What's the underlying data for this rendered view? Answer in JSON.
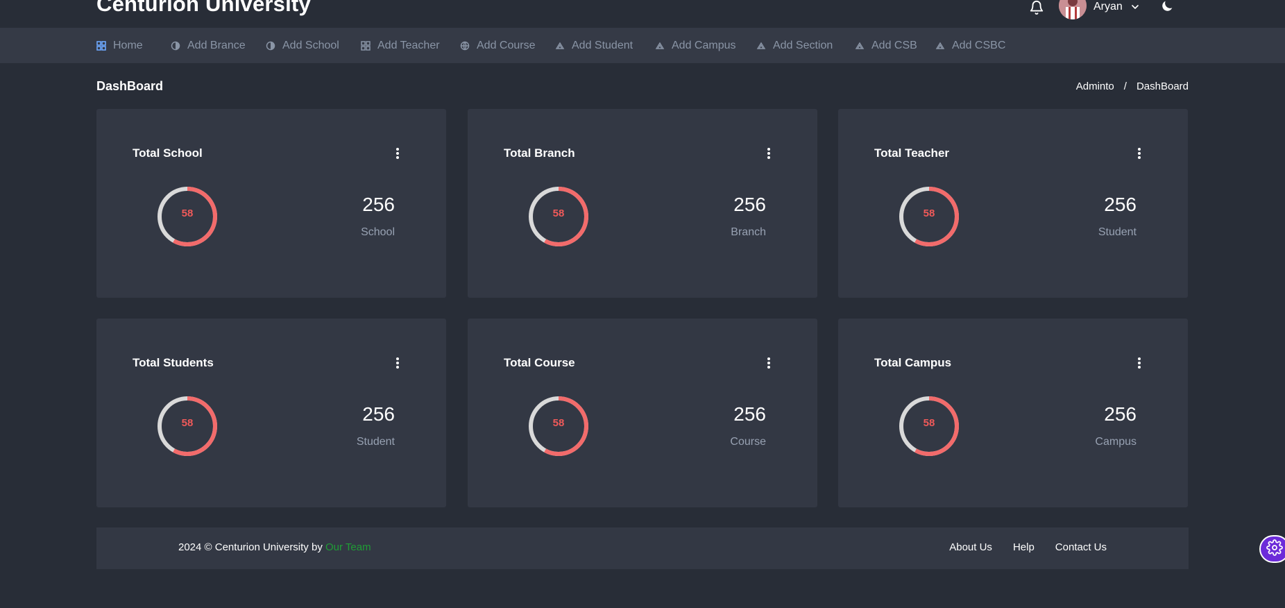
{
  "header": {
    "brand": "Centurion University",
    "username": "Aryan"
  },
  "nav": {
    "items": [
      {
        "label": "Home",
        "icon": "grid-icon"
      },
      {
        "label": "Add Brance",
        "icon": "half-circle-icon"
      },
      {
        "label": "Add School",
        "icon": "half-circle-icon"
      },
      {
        "label": "Add Teacher",
        "icon": "grid-icon"
      },
      {
        "label": "Add Course",
        "icon": "globe-icon"
      },
      {
        "label": "Add Student",
        "icon": "layers-icon"
      },
      {
        "label": "Add Campus",
        "icon": "layers-icon"
      },
      {
        "label": "Add Section",
        "icon": "layers-icon"
      },
      {
        "label": "Add CSB",
        "icon": "layers-icon"
      },
      {
        "label": "Add CSBC",
        "icon": "layers-icon"
      }
    ]
  },
  "page": {
    "title": "DashBoard",
    "breadcrumb": [
      "Adminto",
      "/",
      "DashBoard"
    ]
  },
  "cards": [
    {
      "title": "Total School",
      "donut_value": "58",
      "donut_fraction": 0.58,
      "value": "256",
      "label": "School"
    },
    {
      "title": "Total Branch",
      "donut_value": "58",
      "donut_fraction": 0.58,
      "value": "256",
      "label": "Branch"
    },
    {
      "title": "Total Teacher",
      "donut_value": "58",
      "donut_fraction": 0.58,
      "value": "256",
      "label": "Student"
    },
    {
      "title": "Total Students",
      "donut_value": "58",
      "donut_fraction": 0.58,
      "value": "256",
      "label": "Student"
    },
    {
      "title": "Total Course",
      "donut_value": "58",
      "donut_fraction": 0.58,
      "value": "256",
      "label": "Course"
    },
    {
      "title": "Total Campus",
      "donut_value": "58",
      "donut_fraction": 0.58,
      "value": "256",
      "label": "Campus"
    }
  ],
  "footer": {
    "copyright": "2024 © Centurion University by ",
    "team": "Our Team",
    "links": [
      "About Us",
      "Help",
      "Contact Us"
    ]
  },
  "colors": {
    "background": "#282d37",
    "card": "#333844",
    "navbar": "#353a46",
    "donut_accent": "#f26b6b",
    "donut_track": "#d9d9d9",
    "team_link": "#1f9d35",
    "settings_fab": "#6c2bd9"
  }
}
